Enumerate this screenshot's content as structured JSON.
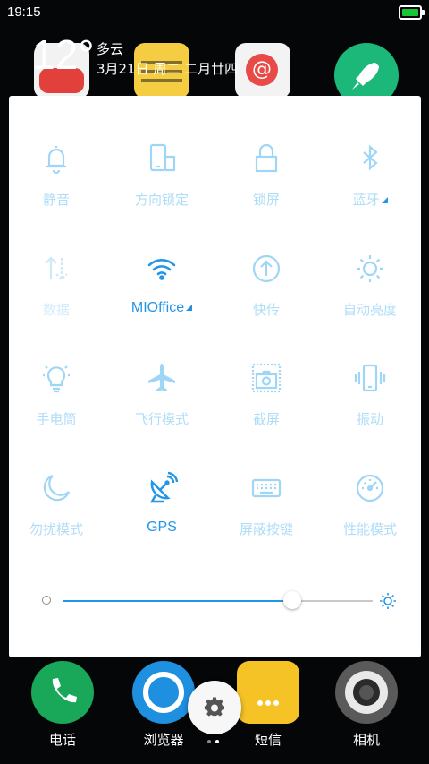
{
  "status_bar": {
    "time": "19:15"
  },
  "weather": {
    "temperature": "12°",
    "condition": "多云",
    "date": "3月21日  周二  二月廿四"
  },
  "quick_settings": [
    {
      "key": "silent",
      "label": "静音",
      "active": false,
      "icon": "bell-icon"
    },
    {
      "key": "rotation",
      "label": "方向锁定",
      "active": false,
      "icon": "phone-rotation-icon"
    },
    {
      "key": "lock",
      "label": "锁屏",
      "active": false,
      "icon": "lock-icon"
    },
    {
      "key": "bluetooth",
      "label": "蓝牙",
      "active": false,
      "icon": "bluetooth-icon",
      "has_more": true
    },
    {
      "key": "data",
      "label": "数据",
      "active": false,
      "icon": "mobile-data-icon"
    },
    {
      "key": "wifi",
      "label": "MIOffice",
      "active": true,
      "icon": "wifi-icon",
      "has_more": true
    },
    {
      "key": "transfer",
      "label": "快传",
      "active": false,
      "icon": "upload-arrow-icon"
    },
    {
      "key": "auto_brightness",
      "label": "自动亮度",
      "active": false,
      "icon": "sun-icon"
    },
    {
      "key": "flashlight",
      "label": "手电筒",
      "active": false,
      "icon": "light-bulb-icon"
    },
    {
      "key": "airplane",
      "label": "飞行模式",
      "active": false,
      "icon": "airplane-icon"
    },
    {
      "key": "screenshot",
      "label": "截屏",
      "active": false,
      "icon": "camera-icon"
    },
    {
      "key": "vibrate",
      "label": "振动",
      "active": false,
      "icon": "vibrate-icon"
    },
    {
      "key": "dnd",
      "label": "勿扰模式",
      "active": false,
      "icon": "moon-icon"
    },
    {
      "key": "gps",
      "label": "GPS",
      "active": true,
      "icon": "satellite-dish-icon"
    },
    {
      "key": "block_keys",
      "label": "屏蔽按键",
      "active": false,
      "icon": "keyboard-icon"
    },
    {
      "key": "performance",
      "label": "性能模式",
      "active": false,
      "icon": "speedometer-icon"
    }
  ],
  "brightness": {
    "level": 0.74
  },
  "dock": [
    {
      "label": "电话",
      "color": "#19a85a",
      "icon": "phone-icon"
    },
    {
      "label": "浏览器",
      "color": "#1f8fe0",
      "icon": "browser-icon"
    },
    {
      "label": "短信",
      "color": "#f5c325",
      "icon": "message-icon"
    },
    {
      "label": "相机",
      "color": "#5a5a5a",
      "icon": "camera-lens-icon"
    }
  ],
  "colors": {
    "accent": "#2496e8",
    "inactive": "#aeddf7",
    "panel": "#ffffff"
  }
}
